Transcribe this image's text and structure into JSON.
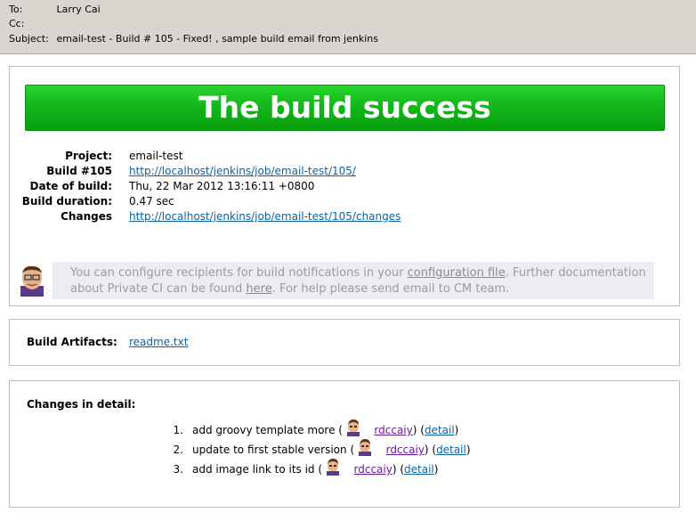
{
  "mail": {
    "to_label": "To:",
    "to_value": "Larry Cai",
    "cc_label": "Cc:",
    "cc_value": "",
    "subject_label": "Subject:",
    "subject_value": "email-test - Build # 105 - Fixed! , sample build email from jenkins"
  },
  "banner": "The build success",
  "build_info": [
    {
      "label": "Project:",
      "value": "email-test",
      "link": false
    },
    {
      "label": "Build #105",
      "value": "http://localhost/jenkins/job/email-test/105/",
      "link": true
    },
    {
      "label": "Date of build:",
      "value": "Thu, 22 Mar 2012 13:16:11 +0800",
      "link": false
    },
    {
      "label": "Build duration:",
      "value": "0.47 sec",
      "link": false
    },
    {
      "label": "Changes",
      "value": "http://localhost/jenkins/job/email-test/105/changes",
      "link": true
    }
  ],
  "notice": {
    "part1": "You can configure recipients for build notifications in your ",
    "link1": "configuration file",
    "part2": ". Further documentation about Private CI can be found ",
    "link2": "here",
    "part3": ". For help please send email to CM team."
  },
  "artifacts": {
    "label": "Build Artifacts:",
    "file": "readme.txt"
  },
  "changes": {
    "label": "Changes in detail:",
    "items": [
      {
        "num": "1.",
        "text": "add groovy template more (",
        "user": "rdccaiy",
        "close": ") (",
        "detail": "detail",
        "end": ")"
      },
      {
        "num": "2.",
        "text": "update to first stable version (",
        "user": "rdccaiy",
        "close": ") (",
        "detail": "detail",
        "end": ")"
      },
      {
        "num": "3.",
        "text": "add image link to its id (",
        "user": "rdccaiy",
        "close": ") (",
        "detail": "detail",
        "end": ")"
      }
    ]
  },
  "colors": {
    "success_green": "#12b81a",
    "link": "#0b63a8",
    "visited": "#6a1b9a"
  }
}
